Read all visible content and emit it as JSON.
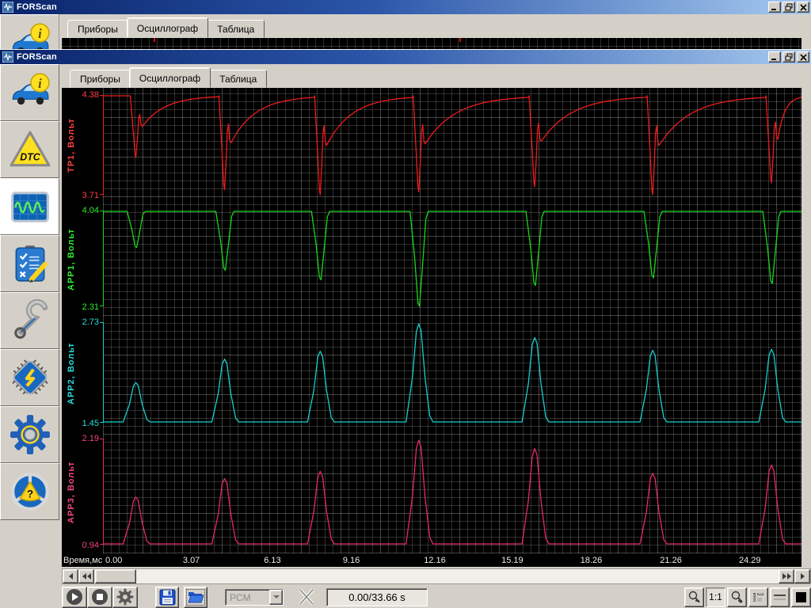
{
  "back_window": {
    "title": "FORScan",
    "tabs": [
      "Приборы",
      "Осциллограф",
      "Таблица"
    ]
  },
  "front_window": {
    "title": "FORScan",
    "tabs": [
      "Приборы",
      "Осциллограф",
      "Таблица"
    ],
    "active_tab": "Осциллограф"
  },
  "sidebar": {
    "items": [
      {
        "name": "vehicle-info",
        "icon": "car-info-icon",
        "glyph": "i",
        "active": false
      },
      {
        "name": "dtc",
        "icon": "dtc-triangle-icon",
        "glyph": "DTC",
        "active": false
      },
      {
        "name": "oscilloscope",
        "icon": "oscilloscope-icon",
        "glyph": "",
        "active": true
      },
      {
        "name": "tests",
        "icon": "checklist-pencil-icon",
        "glyph": "",
        "active": false
      },
      {
        "name": "service",
        "icon": "wrench-icon",
        "glyph": "",
        "active": false
      },
      {
        "name": "programming",
        "icon": "chip-icon",
        "glyph": "S",
        "active": false
      },
      {
        "name": "settings",
        "icon": "gear-icon",
        "glyph": "",
        "active": false
      },
      {
        "name": "help",
        "icon": "steering-wheel-question-icon",
        "glyph": "?",
        "active": false
      }
    ]
  },
  "scope": {
    "xlabel": "Время,мс",
    "x_ticks": [
      "0.00",
      "3.07",
      "6.13",
      "9.16",
      "12.16",
      "15.19",
      "18.26",
      "21.26",
      "24.29"
    ],
    "events": [
      0.047,
      0.174,
      0.311,
      0.452,
      0.618,
      0.787,
      0.957
    ],
    "channels": [
      {
        "name": "TP1, Вольт",
        "color": "#ee1c1c",
        "label_color": "#ff4040",
        "max": "4.38",
        "min": "3.71",
        "mode": "decay",
        "amps": [
          0.62,
          0.95,
          1.0,
          0.97,
          0.92,
          1.0,
          0.88
        ]
      },
      {
        "name": "APP1, Вольт",
        "color": "#18d818",
        "label_color": "#30ee30",
        "max": "4.04",
        "min": "2.31",
        "mode": "vdip",
        "amps": [
          0.38,
          0.62,
          0.72,
          1.0,
          0.78,
          0.7,
          0.76
        ]
      },
      {
        "name": "APP2, Вольт",
        "color": "#16cfcf",
        "label_color": "#2adddd",
        "max": "2.73",
        "min": "1.45",
        "mode": "peak",
        "amps": [
          0.4,
          0.64,
          0.72,
          1.0,
          0.86,
          0.73,
          0.74
        ]
      },
      {
        "name": "APP3, Вольт",
        "color": "#e62a62",
        "label_color": "#f04878",
        "max": "2.19",
        "min": "0.94",
        "mode": "peak",
        "amps": [
          0.45,
          0.63,
          0.7,
          1.0,
          0.92,
          0.68,
          0.76
        ]
      }
    ]
  },
  "toolbar": {
    "device": "PCM",
    "counter": "0.00/33.66 s",
    "scale": "1:1"
  },
  "chart_data": {
    "type": "line",
    "title": "FORScan oscilloscope — throttle / accelerator pedal position sensors",
    "xlabel": "Время,мс",
    "x_range_ms": [
      0,
      27.6
    ],
    "x_tick_labels_ms": [
      0.0,
      3.07,
      6.13,
      9.16,
      12.16,
      15.19,
      18.26,
      21.26,
      24.29
    ],
    "event_times_ms": [
      1.3,
      4.7,
      8.4,
      12.2,
      16.6,
      21.2,
      25.7
    ],
    "legend_position": "left-rotated-per-channel",
    "grid": true,
    "series": [
      {
        "name": "TP1, Вольт",
        "color": "#ee1c1c",
        "axis_range_v": [
          3.71,
          4.38
        ],
        "baseline_v": 4.38,
        "shape": "sharp drop then slow recovery",
        "event_extreme_v": [
          3.96,
          3.74,
          3.71,
          3.73,
          3.76,
          3.71,
          3.79
        ]
      },
      {
        "name": "APP1, Вольт",
        "color": "#18d818",
        "axis_range_v": [
          2.31,
          4.04
        ],
        "baseline_v": 4.04,
        "shape": "sharp V dip",
        "event_extreme_v": [
          3.38,
          2.97,
          2.79,
          2.31,
          2.69,
          2.83,
          2.73
        ]
      },
      {
        "name": "APP2, Вольт",
        "color": "#16cfcf",
        "axis_range_v": [
          1.45,
          2.73
        ],
        "baseline_v": 1.45,
        "shape": "sharp peak",
        "event_extreme_v": [
          1.96,
          2.27,
          2.37,
          2.73,
          2.55,
          2.38,
          2.4
        ]
      },
      {
        "name": "APP3, Вольт",
        "color": "#e62a62",
        "axis_range_v": [
          0.94,
          2.19
        ],
        "baseline_v": 0.94,
        "shape": "sharp peak",
        "event_extreme_v": [
          1.5,
          1.73,
          1.82,
          2.19,
          2.09,
          1.79,
          1.89
        ]
      }
    ]
  }
}
